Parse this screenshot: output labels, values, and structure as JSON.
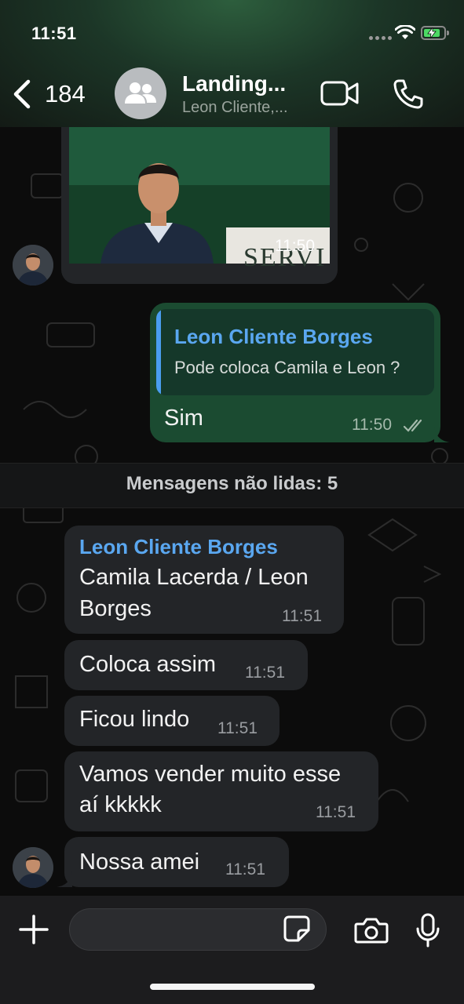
{
  "status_bar": {
    "time": "11:51"
  },
  "header": {
    "back_count": "184",
    "title": "Landing...",
    "subtitle": "Leon Cliente,..."
  },
  "messages": {
    "image_msg": {
      "time": "11:50",
      "caption_fragment": "SERVI"
    },
    "outgoing": {
      "reply_sender": "Leon Cliente Borges",
      "reply_text": "Pode coloca Camila e Leon ?",
      "text": "Sim",
      "time": "11:50"
    },
    "unread_label": "Mensagens não lidas: 5",
    "incoming": [
      {
        "sender": "Leon Cliente Borges",
        "line1": "Camila Lacerda / Leon",
        "line2": "Borges",
        "time": "11:51"
      },
      {
        "text": "Coloca assim",
        "time": "11:51"
      },
      {
        "text": "Ficou lindo",
        "time": "11:51"
      },
      {
        "line1": "Vamos vender muito esse",
        "line2": "aí kkkkk",
        "time": "11:51"
      },
      {
        "text": "Nossa amei",
        "time": "11:51"
      }
    ]
  },
  "colors": {
    "outgoing_bubble": "#1b4b31",
    "incoming_bubble": "#232528",
    "sender_name": "#5aa7f0",
    "reply_bar": "#4a9df0"
  },
  "icons": [
    "back-chevron-icon",
    "group-icon",
    "video-call-icon",
    "phone-icon",
    "plus-icon",
    "sticker-icon",
    "camera-icon",
    "microphone-icon",
    "double-check-icon",
    "wifi-icon",
    "battery-charging-icon"
  ]
}
